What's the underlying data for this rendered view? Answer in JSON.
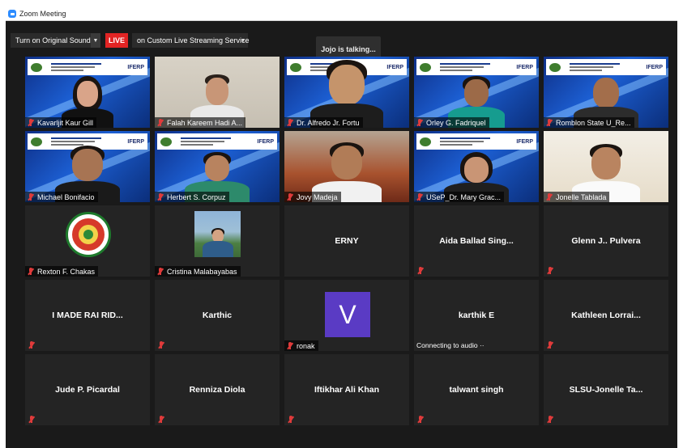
{
  "window": {
    "title": "Zoom Meeting"
  },
  "toolbar": {
    "original_sound_label": "Turn on Original Sound",
    "live_badge": "LIVE",
    "stream_label": "on Custom Live Streaming Service",
    "talking_indicator": "Jojo is talking..."
  },
  "tiles": [
    {
      "name": "Kavarljit Kaur Gill",
      "video": true
    },
    {
      "name": "Falah Kareem Hadi A...",
      "video": true
    },
    {
      "name": "Dr. Alfredo Jr. Fortu",
      "video": true
    },
    {
      "name": "Orley G. Fadriquel",
      "video": true
    },
    {
      "name": "Romblon State U_Re...",
      "video": true
    },
    {
      "name": "Michael Bonifacio",
      "video": true
    },
    {
      "name": "Herbert S. Corpuz",
      "video": true
    },
    {
      "name": "Jovy Madeja",
      "video": true
    },
    {
      "name": "USeP_Dr. Mary Grac...",
      "video": true
    },
    {
      "name": "Jonelle Tablada",
      "video": true
    },
    {
      "name": "Rexton F. Chakas",
      "video": false
    },
    {
      "name": "Cristina Malabayabas",
      "video": false
    },
    {
      "name": "ERNY",
      "video": false
    },
    {
      "name": "Aida Ballad Sing...",
      "video": false
    },
    {
      "name": "Glenn J.. Pulvera",
      "video": false
    },
    {
      "name": "I MADE RAI RID...",
      "video": false
    },
    {
      "name": "Karthic",
      "video": false
    },
    {
      "name": "ronak",
      "avatar_letter": "V",
      "video": false
    },
    {
      "name": "karthik E",
      "status": "Connecting to audio ··",
      "video": false
    },
    {
      "name": "Kathleen Lorrai...",
      "video": false
    },
    {
      "name": "Jude P. Picardal",
      "video": false
    },
    {
      "name": "Renniza Diola",
      "video": false
    },
    {
      "name": "Iftikhar Ali Khan",
      "video": false
    },
    {
      "name": "talwant singh",
      "video": false
    },
    {
      "name": "SLSU-Jonelle Ta...",
      "video": false
    }
  ],
  "banner": {
    "brand": "IFERP"
  },
  "colors": {
    "live": "#e22424",
    "muted_mic": "#e03b3b",
    "avatar": "#5a3bc4",
    "background": "#1a1a1a",
    "tile": "#242424"
  }
}
